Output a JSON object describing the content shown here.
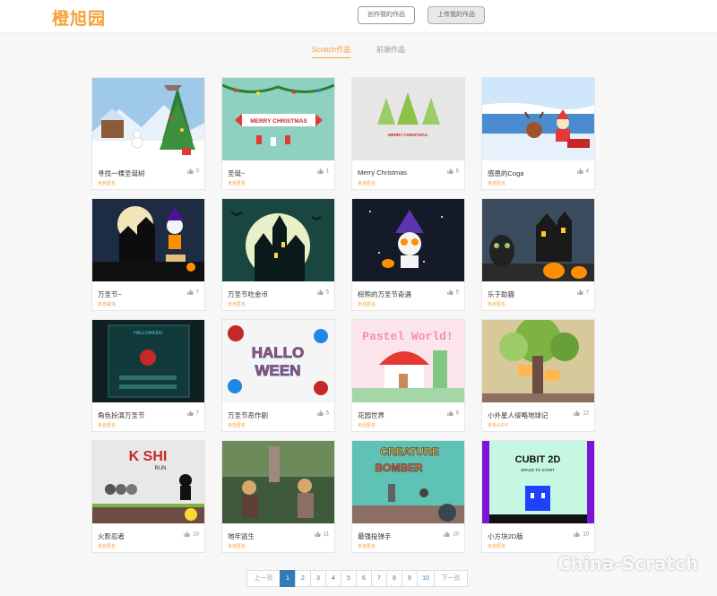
{
  "header": {
    "logo": "橙旭园",
    "create_label": "创作我的作品",
    "upload_label": "上传我的作品"
  },
  "tabs": [
    {
      "label": "Scratch作品",
      "active": true
    },
    {
      "label": "前端作品",
      "active": false
    }
  ],
  "cards": [
    {
      "title": "寻找一棵圣诞树",
      "author": "未自匿名",
      "likes": "0",
      "thumb": "christmas-tree-village"
    },
    {
      "title": "圣诞~",
      "author": "未自匿名",
      "likes": "1",
      "thumb": "merry-christmas-banner"
    },
    {
      "title": "Merry Christmas",
      "author": "未自匿名",
      "likes": "6",
      "thumb": "merry-christmas-trees"
    },
    {
      "title": "感恩的Coga",
      "author": "未自匿名",
      "likes": "4",
      "thumb": "santa-reindeer-sleigh"
    },
    {
      "title": "万圣节~",
      "author": "未自威洛",
      "likes": "7",
      "thumb": "halloween-haunted-house"
    },
    {
      "title": "万圣节吃金币",
      "author": "未自匿名",
      "likes": "5",
      "thumb": "halloween-castle-moon"
    },
    {
      "title": "棕熊的万圣节奇遇",
      "author": "未自匿名",
      "likes": "5",
      "thumb": "halloween-witch-bear"
    },
    {
      "title": "乐于助猫",
      "author": "未自匿名",
      "likes": "7",
      "thumb": "halloween-cat-pumpkins"
    },
    {
      "title": "角色扮演万圣节",
      "author": "未自匿名",
      "likes": "7",
      "thumb": "halloween-game-menu"
    },
    {
      "title": "万圣节恶作剧",
      "author": "未自匿名",
      "likes": "5",
      "thumb": "halloween-ween-logo"
    },
    {
      "title": "花园世界",
      "author": "未自匿名",
      "likes": "9",
      "thumb": "pastel-world"
    },
    {
      "title": "小外星人侵略地球记",
      "author": "未自JUDY",
      "likes": "12",
      "thumb": "alien-tree-house"
    },
    {
      "title": "火影忍者",
      "author": "未自匿名",
      "likes": "10",
      "thumb": "koshi-run-ninja"
    },
    {
      "title": "地牢逃生",
      "author": "未自匿名",
      "likes": "11",
      "thumb": "dungeon-escape-warriors"
    },
    {
      "title": "最强投弹手",
      "author": "未自匿名",
      "likes": "10",
      "thumb": "creature-bomber"
    },
    {
      "title": "小方块2D版",
      "author": "未自匿名",
      "likes": "10",
      "thumb": "cubit-2d"
    }
  ],
  "thumb_texts": {
    "merry_christmas": "MERRY CHRISTMAS",
    "merry_christmas_small": "MERRY CHRISTMAS",
    "hallo": "HALLO",
    "ween": "WEEN",
    "pastel": "Pastel World!",
    "koshi": "K SHI",
    "run": "RUN",
    "creature": "CREATURE",
    "bomber": "BOMBER",
    "cubit": "CUBIT 2D",
    "space": "SPACE TO START",
    "halloween_menu": "HALLOWEEN"
  },
  "pagination": {
    "prev": "上一页",
    "pages": [
      "1",
      "2",
      "3",
      "4",
      "5",
      "6",
      "7",
      "8",
      "9",
      "10"
    ],
    "current": "1",
    "next": "下一页"
  },
  "watermark": "China-Scratch",
  "colors": {
    "accent": "#f5a13b",
    "pager_active": "#337ab7"
  }
}
